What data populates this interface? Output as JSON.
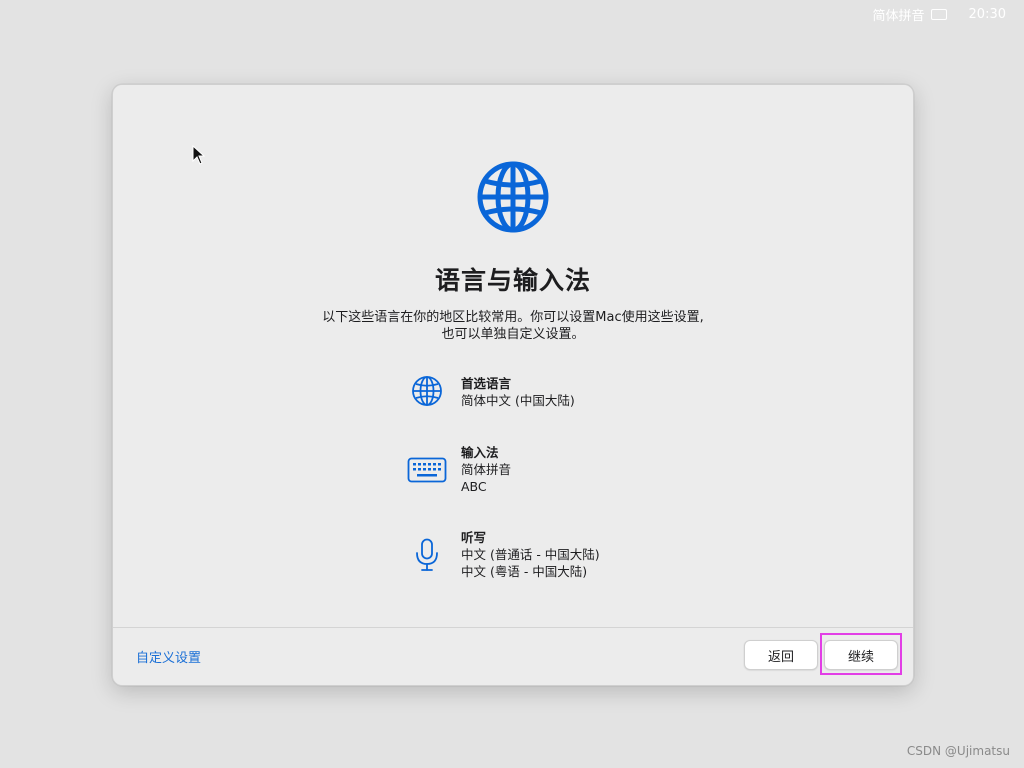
{
  "menubar": {
    "input_method": "简体拼音",
    "clock": "20:30"
  },
  "dialog": {
    "title": "语言与输入法",
    "description": [
      "以下这些语言在你的地区比较常用。你可以设置Mac使用这些设置,",
      "也可以单独自定义设置。"
    ],
    "settings": [
      {
        "title": "首选语言",
        "values": [
          "简体中文 (中国大陆)"
        ],
        "icon": "globe-icon"
      },
      {
        "title": "输入法",
        "values": [
          "简体拼音",
          "ABC"
        ],
        "icon": "keyboard-icon"
      },
      {
        "title": "听写",
        "values": [
          "中文 (普通话 - 中国大陆)",
          "中文 (粤语 - 中国大陆)"
        ],
        "icon": "microphone-icon"
      }
    ],
    "custom_link": "自定义设置",
    "back_button": "返回",
    "continue_button": "继续"
  },
  "watermark": "CSDN @Ujimatsu",
  "colors": {
    "accent": "#1a6fd6",
    "icon_blue": "#0a66d8",
    "highlight": "#e23ee6"
  }
}
